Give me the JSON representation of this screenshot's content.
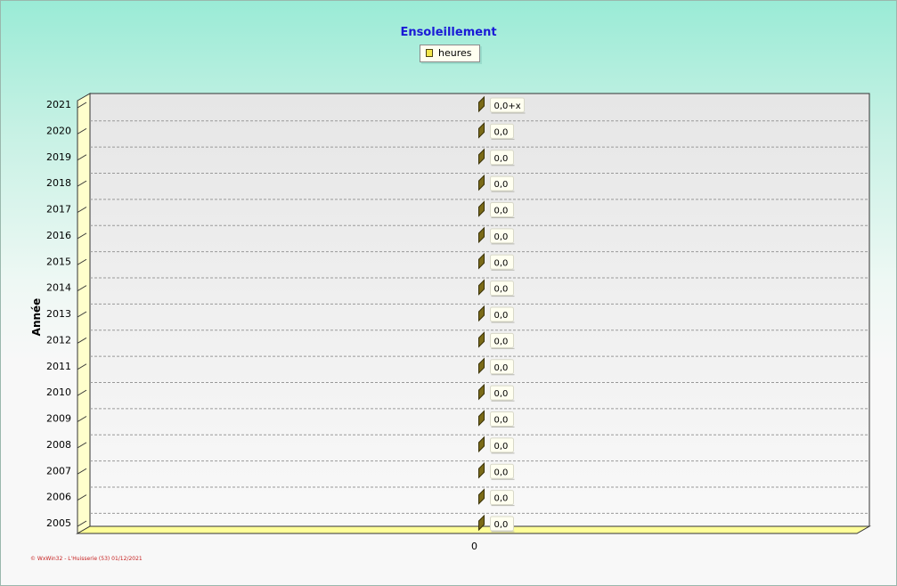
{
  "chart_data": {
    "type": "bar",
    "orientation": "horizontal",
    "title": "Ensoleillement",
    "ylabel": "Année",
    "xlabel": "",
    "legend": "top-center",
    "grid": true,
    "categories": [
      "2021",
      "2020",
      "2019",
      "2018",
      "2017",
      "2016",
      "2015",
      "2014",
      "2013",
      "2012",
      "2011",
      "2010",
      "2009",
      "2008",
      "2007",
      "2006",
      "2005"
    ],
    "series": [
      {
        "name": "heures",
        "values": [
          0,
          0,
          0,
          0,
          0,
          0,
          0,
          0,
          0,
          0,
          0,
          0,
          0,
          0,
          0,
          0,
          0
        ],
        "labels": [
          "0,0+x",
          "0,0",
          "0,0",
          "0,0",
          "0,0",
          "0,0",
          "0,0",
          "0,0",
          "0,0",
          "0,0",
          "0,0",
          "0,0",
          "0,0",
          "0,0",
          "0,0",
          "0,0",
          "0,0"
        ]
      }
    ],
    "x_ticks": [
      "0"
    ],
    "xlim": [
      -1,
      1
    ]
  },
  "footer": "© WxWin32 - L'Huisserie (53) 01/12/2021",
  "colors": {
    "title": "#1a1ad6",
    "bar_face": "#f2e64a",
    "bar_dark": "#7a6a18",
    "floor": "#ffff99",
    "footer": "#c62020",
    "grid": "#999999"
  }
}
